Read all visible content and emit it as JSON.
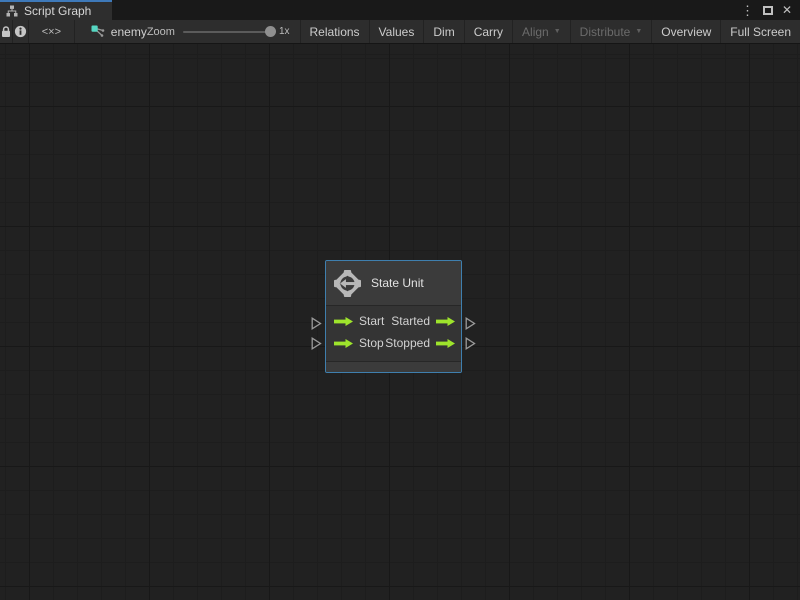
{
  "window": {
    "tab_title": "Script Graph"
  },
  "window_controls": {
    "menu_glyph": "⋮",
    "close_glyph": "✕"
  },
  "toolbar": {
    "code_button_glyph": "<×>",
    "graph_name": "enemy",
    "zoom": {
      "label": "Zoom",
      "value": "1x"
    },
    "dropdown_glyph": "▼",
    "buttons": [
      {
        "label": "Relations",
        "enabled": true
      },
      {
        "label": "Values",
        "enabled": true
      },
      {
        "label": "Dim",
        "enabled": true
      },
      {
        "label": "Carry",
        "enabled": true
      },
      {
        "label": "Align",
        "enabled": false,
        "dropdown": true
      },
      {
        "label": "Distribute",
        "enabled": false,
        "dropdown": true
      },
      {
        "label": "Overview",
        "enabled": true
      },
      {
        "label": "Full Screen",
        "enabled": true
      }
    ]
  },
  "node": {
    "title": "State Unit",
    "rows": [
      {
        "input": "Start",
        "output": "Started"
      },
      {
        "input": "Stop",
        "output": "Stopped"
      }
    ]
  },
  "colors": {
    "selection_blue": "#3f7fae",
    "tab_accent_blue": "#3e79b9",
    "port_green": "#9ee42c",
    "graph_icon_teal": "#56d6c2",
    "canvas_bg": "#212121"
  }
}
